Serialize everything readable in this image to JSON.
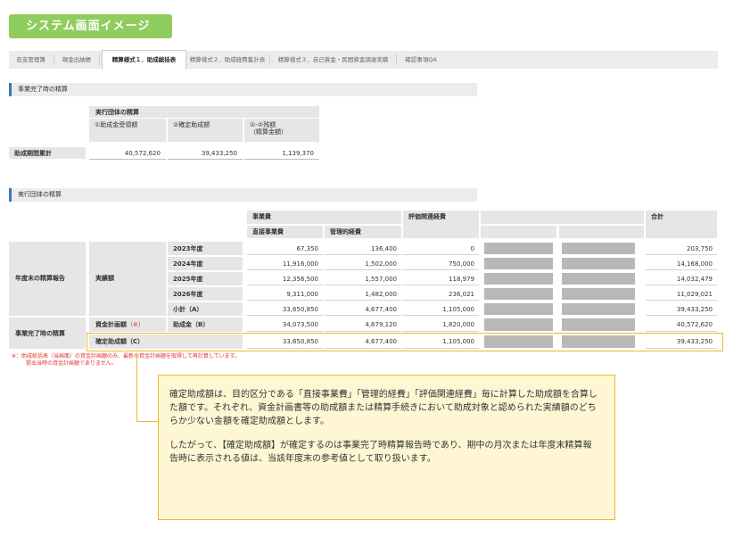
{
  "header": {
    "title": "システム画面イメージ"
  },
  "tabs": [
    {
      "label": "収支管理簿",
      "active": false
    },
    {
      "label": "現金出納帳",
      "active": false
    },
    {
      "label": "精算様式１．助成総括表",
      "active": true
    },
    {
      "label": "精算様式２．助成経費集計表",
      "active": false
    },
    {
      "label": "精算様式３．自己資金・民間資金調達実績",
      "active": false
    },
    {
      "label": "確認事項QA",
      "active": false
    }
  ],
  "section1": {
    "title": "事業完了時の精算",
    "group_header": "実行団体の精算",
    "col1": "①助成金受領額",
    "col2": "②確定助成額",
    "col3_line1": "①-②残額",
    "col3_line2": "（精算金額）",
    "row_label": "助成期間累計",
    "values": [
      "40,572,620",
      "39,433,250",
      "1,139,370"
    ]
  },
  "section2": {
    "title": "実行団体の精算",
    "headers": {
      "jigyohi": "事業費",
      "chokusetsu": "直接事業費",
      "kanri": "管理的経費",
      "hyoka": "評価関連経費",
      "gokei": "合計"
    },
    "group_annual": "年度末の精算報告",
    "actual_label": "実績額",
    "years": [
      {
        "label": "2023年度",
        "direct": "67,350",
        "admin": "136,400",
        "eval": "0",
        "total": "203,750"
      },
      {
        "label": "2024年度",
        "direct": "11,916,000",
        "admin": "1,502,000",
        "eval": "750,000",
        "total": "14,168,000"
      },
      {
        "label": "2025年度",
        "direct": "12,356,500",
        "admin": "1,557,000",
        "eval": "118,979",
        "total": "14,032,479"
      },
      {
        "label": "2026年度",
        "direct": "9,311,000",
        "admin": "1,482,000",
        "eval": "236,021",
        "total": "11,029,021"
      }
    ],
    "subtotal": {
      "label": "小計（A）",
      "direct": "33,650,850",
      "admin": "4,677,400",
      "eval": "1,105,000",
      "total": "39,433,250"
    },
    "group_final": "事業完了時の精算",
    "plan_label": "資金計画額",
    "plan_mark": "（※）",
    "grant_b": {
      "label": "助成金（B）",
      "direct": "34,073,500",
      "admin": "4,679,120",
      "eval": "1,820,000",
      "total": "40,572,620"
    },
    "confirmed": {
      "label": "確定助成額（C）",
      "direct": "33,650,850",
      "admin": "4,677,400",
      "eval": "1,105,000",
      "total": "39,433,250"
    }
  },
  "note": {
    "line1": "※：助成総括表（当画面）の資金計画額のみ、最新の資金計画額を取得して再計算しています。",
    "line2": "提出当時の資金計画額でありません。"
  },
  "callout": {
    "para1": "確定助成額は、目的区分である「直接事業費」「管理的経費」「評価関連経費」毎に計算した助成額を合算した額です。それぞれ、資金計画書等の助成額または精算手続きにおいて助成対象と認められた実績額のどちらか少ない金額を確定助成額とします。",
    "para2": "したがって、【確定助成額】が確定するのは事業完了時精算報告時であり、期中の月次または年度末精算報告時に表示される値は、当該年度末の参考値として取り扱います。"
  },
  "colors": {
    "title_green": "#8fcd5f",
    "highlight_orange": "#f1b82a",
    "callout_bg": "#fff7d4",
    "note_red": "#e2332b",
    "section_blue": "#3a77b8"
  }
}
